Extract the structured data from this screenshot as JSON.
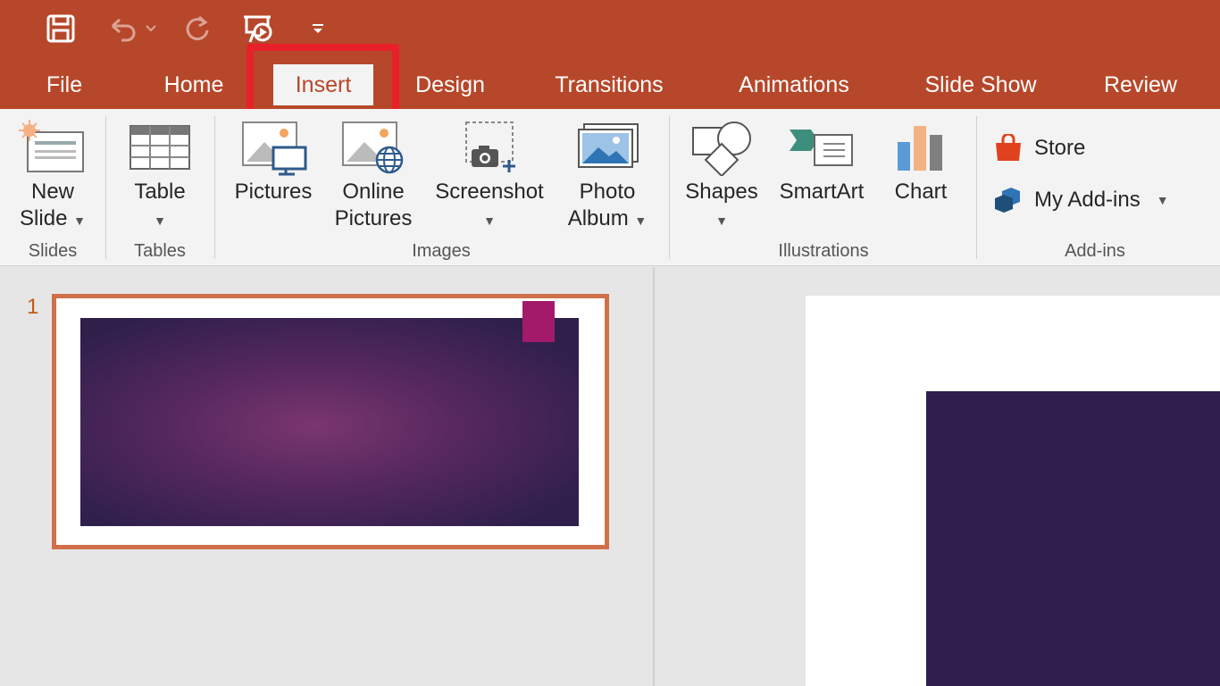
{
  "qat": {
    "save_icon": "save-icon",
    "undo_icon": "undo-icon",
    "redo_icon": "redo-icon",
    "present_icon": "start-from-beginning-icon",
    "customize_icon": "customize-qat-icon"
  },
  "tabs": [
    {
      "label": "File"
    },
    {
      "label": "Home"
    },
    {
      "label": "Insert"
    },
    {
      "label": "Design"
    },
    {
      "label": "Transitions"
    },
    {
      "label": "Animations"
    },
    {
      "label": "Slide Show"
    },
    {
      "label": "Review"
    }
  ],
  "active_tab": "Insert",
  "ribbon": {
    "new_slide": {
      "line1": "New",
      "line2": "Slide"
    },
    "table": {
      "label": "Table"
    },
    "pictures": {
      "label": "Pictures"
    },
    "online_pictures": {
      "line1": "Online",
      "line2": "Pictures"
    },
    "screenshot": {
      "label": "Screenshot"
    },
    "photo_album": {
      "line1": "Photo",
      "line2": "Album"
    },
    "shapes": {
      "label": "Shapes"
    },
    "smartart": {
      "label": "SmartArt"
    },
    "chart": {
      "label": "Chart"
    },
    "store": {
      "label": "Store"
    },
    "my_addins": {
      "label": "My Add-ins"
    },
    "groups": {
      "slides": "Slides",
      "tables": "Tables",
      "images": "Images",
      "illustrations": "Illustrations",
      "addins": "Add-ins"
    }
  },
  "slides_pane": {
    "slide_number": "1"
  },
  "colors": {
    "accent": "#b7472a",
    "highlight": "#e8202a",
    "slide_bg": "#2f1f4e",
    "tag": "#a31a6a"
  }
}
